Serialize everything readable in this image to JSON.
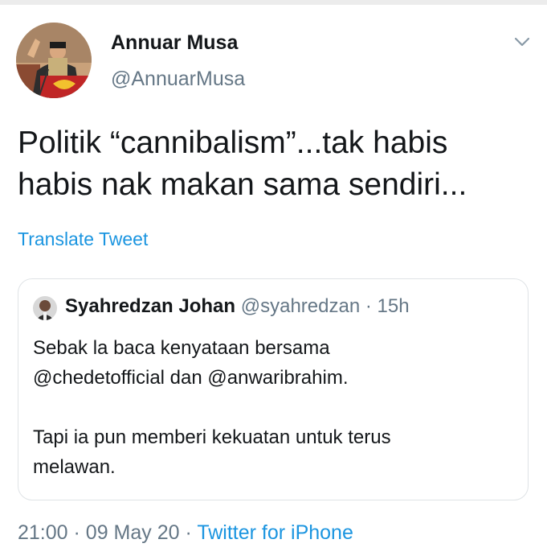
{
  "tweet": {
    "author": {
      "name": "Annuar Musa",
      "handle": "@AnnuarMusa"
    },
    "text_line1": "Politik “cannibalism”...tak habis",
    "text_line2": "habis nak makan sama sendiri...",
    "translate_label": "Translate Tweet",
    "menu_icon": "chevron-down-icon"
  },
  "quoted_tweet": {
    "name": "Syahredzan Johan",
    "handle": "@syahredzan",
    "separator": "·",
    "time": "15h",
    "text_line1": "Sebak la baca kenyataan bersama",
    "text_line2": "@chedetofficial dan @anwaribrahim.",
    "text_line3": "Tapi ia pun memberi kekuatan untuk terus",
    "text_line4": "melawan."
  },
  "footer": {
    "time": "21:00",
    "separator1": "·",
    "date": "09 May 20",
    "separator2": "·",
    "source": "Twitter for iPhone"
  },
  "colors": {
    "link": "#1b95e0",
    "muted": "#657786",
    "text": "#14171a",
    "border": "#dfe3e6"
  }
}
